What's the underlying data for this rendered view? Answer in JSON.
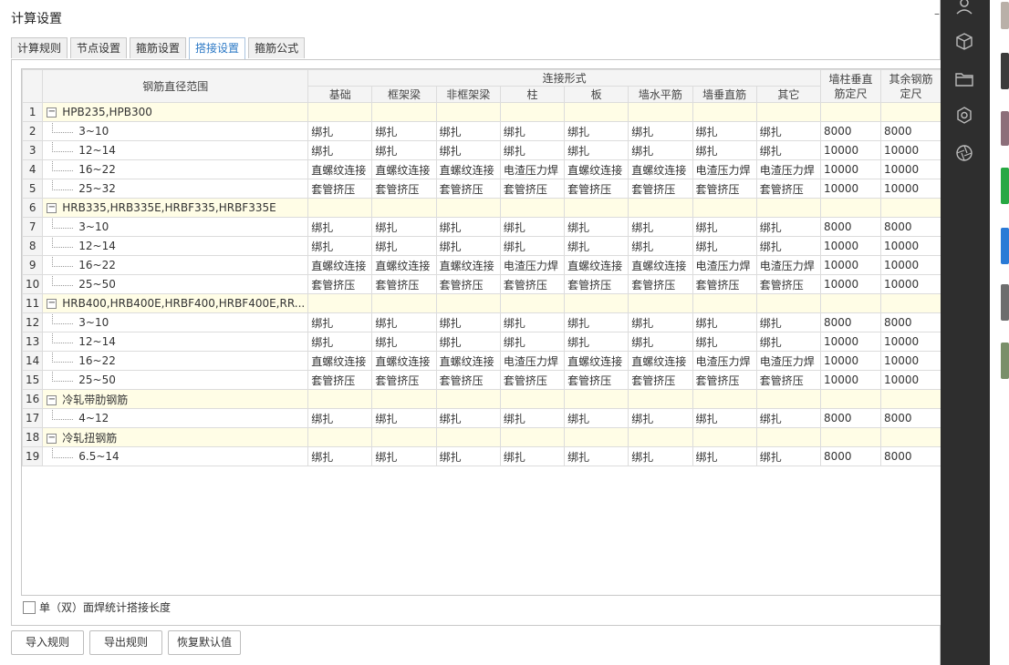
{
  "dialog": {
    "title": "计算设置",
    "minimize": "–",
    "tabs": [
      {
        "label": "计算规则",
        "active": false
      },
      {
        "label": "节点设置",
        "active": false
      },
      {
        "label": "箍筋设置",
        "active": false
      },
      {
        "label": "搭接设置",
        "active": true
      },
      {
        "label": "箍筋公式",
        "active": false
      }
    ]
  },
  "grid": {
    "header": {
      "range": "钢筋直径范围",
      "conn_group": "连接形式",
      "conn_cols": [
        "基础",
        "框架梁",
        "非框架梁",
        "柱",
        "板",
        "墙水平筋",
        "墙垂直筋",
        "其它"
      ],
      "wall_col": "墙柱垂直筋定尺",
      "other_col": "其余钢筋定尺"
    },
    "rows": [
      {
        "n": "1",
        "group": true,
        "label": "HPB235,HPB300"
      },
      {
        "n": "2",
        "label": "3~10",
        "c": [
          "绑扎",
          "绑扎",
          "绑扎",
          "绑扎",
          "绑扎",
          "绑扎",
          "绑扎",
          "绑扎"
        ],
        "w": "8000",
        "o": "8000"
      },
      {
        "n": "3",
        "label": "12~14",
        "c": [
          "绑扎",
          "绑扎",
          "绑扎",
          "绑扎",
          "绑扎",
          "绑扎",
          "绑扎",
          "绑扎"
        ],
        "w": "10000",
        "o": "10000"
      },
      {
        "n": "4",
        "label": "16~22",
        "c": [
          "直螺纹连接",
          "直螺纹连接",
          "直螺纹连接",
          "电渣压力焊",
          "直螺纹连接",
          "直螺纹连接",
          "电渣压力焊",
          "电渣压力焊"
        ],
        "w": "10000",
        "o": "10000"
      },
      {
        "n": "5",
        "label": "25~32",
        "c": [
          "套管挤压",
          "套管挤压",
          "套管挤压",
          "套管挤压",
          "套管挤压",
          "套管挤压",
          "套管挤压",
          "套管挤压"
        ],
        "w": "10000",
        "o": "10000"
      },
      {
        "n": "6",
        "group": true,
        "label": "HRB335,HRB335E,HRBF335,HRBF335E"
      },
      {
        "n": "7",
        "label": "3~10",
        "c": [
          "绑扎",
          "绑扎",
          "绑扎",
          "绑扎",
          "绑扎",
          "绑扎",
          "绑扎",
          "绑扎"
        ],
        "w": "8000",
        "o": "8000"
      },
      {
        "n": "8",
        "label": "12~14",
        "c": [
          "绑扎",
          "绑扎",
          "绑扎",
          "绑扎",
          "绑扎",
          "绑扎",
          "绑扎",
          "绑扎"
        ],
        "w": "10000",
        "o": "10000"
      },
      {
        "n": "9",
        "label": "16~22",
        "c": [
          "直螺纹连接",
          "直螺纹连接",
          "直螺纹连接",
          "电渣压力焊",
          "直螺纹连接",
          "直螺纹连接",
          "电渣压力焊",
          "电渣压力焊"
        ],
        "w": "10000",
        "o": "10000"
      },
      {
        "n": "10",
        "label": "25~50",
        "c": [
          "套管挤压",
          "套管挤压",
          "套管挤压",
          "套管挤压",
          "套管挤压",
          "套管挤压",
          "套管挤压",
          "套管挤压"
        ],
        "w": "10000",
        "o": "10000"
      },
      {
        "n": "11",
        "group": true,
        "label": "HRB400,HRB400E,HRBF400,HRBF400E,RR..."
      },
      {
        "n": "12",
        "label": "3~10",
        "c": [
          "绑扎",
          "绑扎",
          "绑扎",
          "绑扎",
          "绑扎",
          "绑扎",
          "绑扎",
          "绑扎"
        ],
        "w": "8000",
        "o": "8000"
      },
      {
        "n": "13",
        "label": "12~14",
        "c": [
          "绑扎",
          "绑扎",
          "绑扎",
          "绑扎",
          "绑扎",
          "绑扎",
          "绑扎",
          "绑扎"
        ],
        "w": "10000",
        "o": "10000"
      },
      {
        "n": "14",
        "label": "16~22",
        "c": [
          "直螺纹连接",
          "直螺纹连接",
          "直螺纹连接",
          "电渣压力焊",
          "直螺纹连接",
          "直螺纹连接",
          "电渣压力焊",
          "电渣压力焊"
        ],
        "w": "10000",
        "o": "10000"
      },
      {
        "n": "15",
        "label": "25~50",
        "c": [
          "套管挤压",
          "套管挤压",
          "套管挤压",
          "套管挤压",
          "套管挤压",
          "套管挤压",
          "套管挤压",
          "套管挤压"
        ],
        "w": "10000",
        "o": "10000"
      },
      {
        "n": "16",
        "group": true,
        "label": "冷轧带肋钢筋"
      },
      {
        "n": "17",
        "label": "4~12",
        "c": [
          "绑扎",
          "绑扎",
          "绑扎",
          "绑扎",
          "绑扎",
          "绑扎",
          "绑扎",
          "绑扎"
        ],
        "w": "8000",
        "o": "8000"
      },
      {
        "n": "18",
        "group": true,
        "label": "冷轧扭钢筋"
      },
      {
        "n": "19",
        "label": "6.5~14",
        "c": [
          "绑扎",
          "绑扎",
          "绑扎",
          "绑扎",
          "绑扎",
          "绑扎",
          "绑扎",
          "绑扎"
        ],
        "w": "8000",
        "o": "8000"
      }
    ],
    "collapse_glyph": "−"
  },
  "checkbox_label": "单（双）面焊统计搭接长度",
  "buttons": {
    "import": "导入规则",
    "export": "导出规则",
    "restore": "恢复默认值"
  },
  "sidebar_icons": [
    "user-icon",
    "cube-icon",
    "folder-icon",
    "gear-icon",
    "aperture-icon"
  ],
  "colors": {
    "group_row": "#fffde6",
    "active_tab": "#2b78c5",
    "sidebar": "#2e2e2e"
  }
}
